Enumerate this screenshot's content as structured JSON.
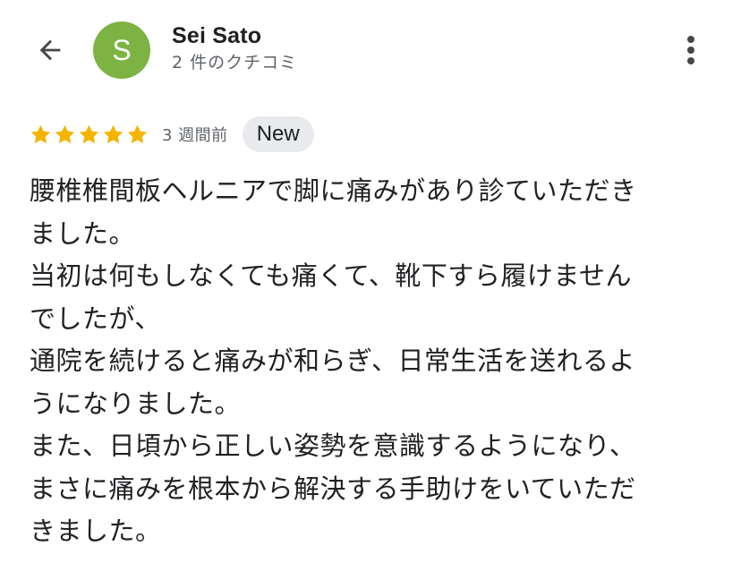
{
  "header": {
    "back_icon": "arrow-back-icon",
    "avatar": {
      "letter": "S",
      "color": "#7cb342"
    },
    "reviewer_name": "Sei Sato",
    "review_count": "2 件のクチコミ",
    "more_icon": "more-vert-icon"
  },
  "review": {
    "rating": 5,
    "max_rating": 5,
    "star_color": "#f4b400",
    "time": "3 週間前",
    "badge": "New",
    "lines": [
      "腰椎椎間板ヘルニアで脚に痛みがあり診ていただき",
      "ました。",
      "当初は何もしなくても痛くて、靴下すら履けません",
      "でしたが、",
      "通院を続けると痛みが和らぎ、日常生活を送れるよ",
      "うになりました。",
      "また、日頃から正しい姿勢を意識するようになり、",
      "まさに痛みを根本から解決する手助けをいていただ",
      "きました。"
    ]
  }
}
